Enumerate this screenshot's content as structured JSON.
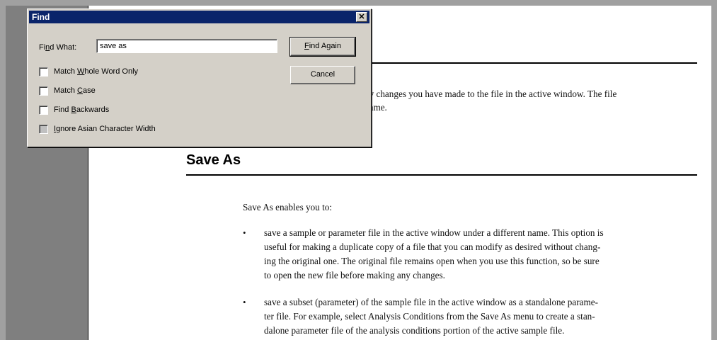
{
  "document": {
    "previous_text": [
      "ny changes you have made to the file in the active window. The file",
      "name."
    ],
    "section_heading": "Save As",
    "intro": "Save As enables you to:",
    "bullet_glyph": "•",
    "bullets": [
      [
        "save a sample or parameter file in the active window under a different name. This option is",
        "useful for making a duplicate copy of a file that you can modify as desired without chang-",
        "ing the original one. The original file remains open when you use this function, so be sure",
        "to open the new file before making any changes."
      ],
      [
        "save a subset (parameter) of the sample file in the active window as a standalone parame-",
        "ter file. For example, select Analysis Conditions from the Save As menu to create a stan-",
        "dalone parameter file of the analysis conditions portion of the active sample file."
      ]
    ]
  },
  "find_dialog": {
    "title": "Find",
    "close_glyph": "✕",
    "find_what": {
      "pre": "Fi",
      "key": "n",
      "post": "d What:"
    },
    "search_value": "save as",
    "find_again": {
      "pre": "",
      "key": "F",
      "post": "ind Again"
    },
    "cancel_label": "Cancel",
    "options": {
      "match_whole_word": {
        "pre": "Match ",
        "key": "W",
        "post": "hole Word Only",
        "checked": false
      },
      "match_case": {
        "pre": "Match ",
        "key": "C",
        "post": "ase",
        "checked": false
      },
      "find_backwards": {
        "pre": "Find ",
        "key": "B",
        "post": "ackwards",
        "checked": false
      },
      "ignore_asian_width": {
        "pre": "",
        "key": "I",
        "post": "gnore Asian Character Width",
        "checked": false,
        "disabled": true
      }
    }
  },
  "colors": {
    "title_bar": "#0a246a",
    "dialog_face": "#d4d0c8",
    "margin_gray": "#7f7f7f",
    "frame_gray": "#a0a0a0"
  }
}
